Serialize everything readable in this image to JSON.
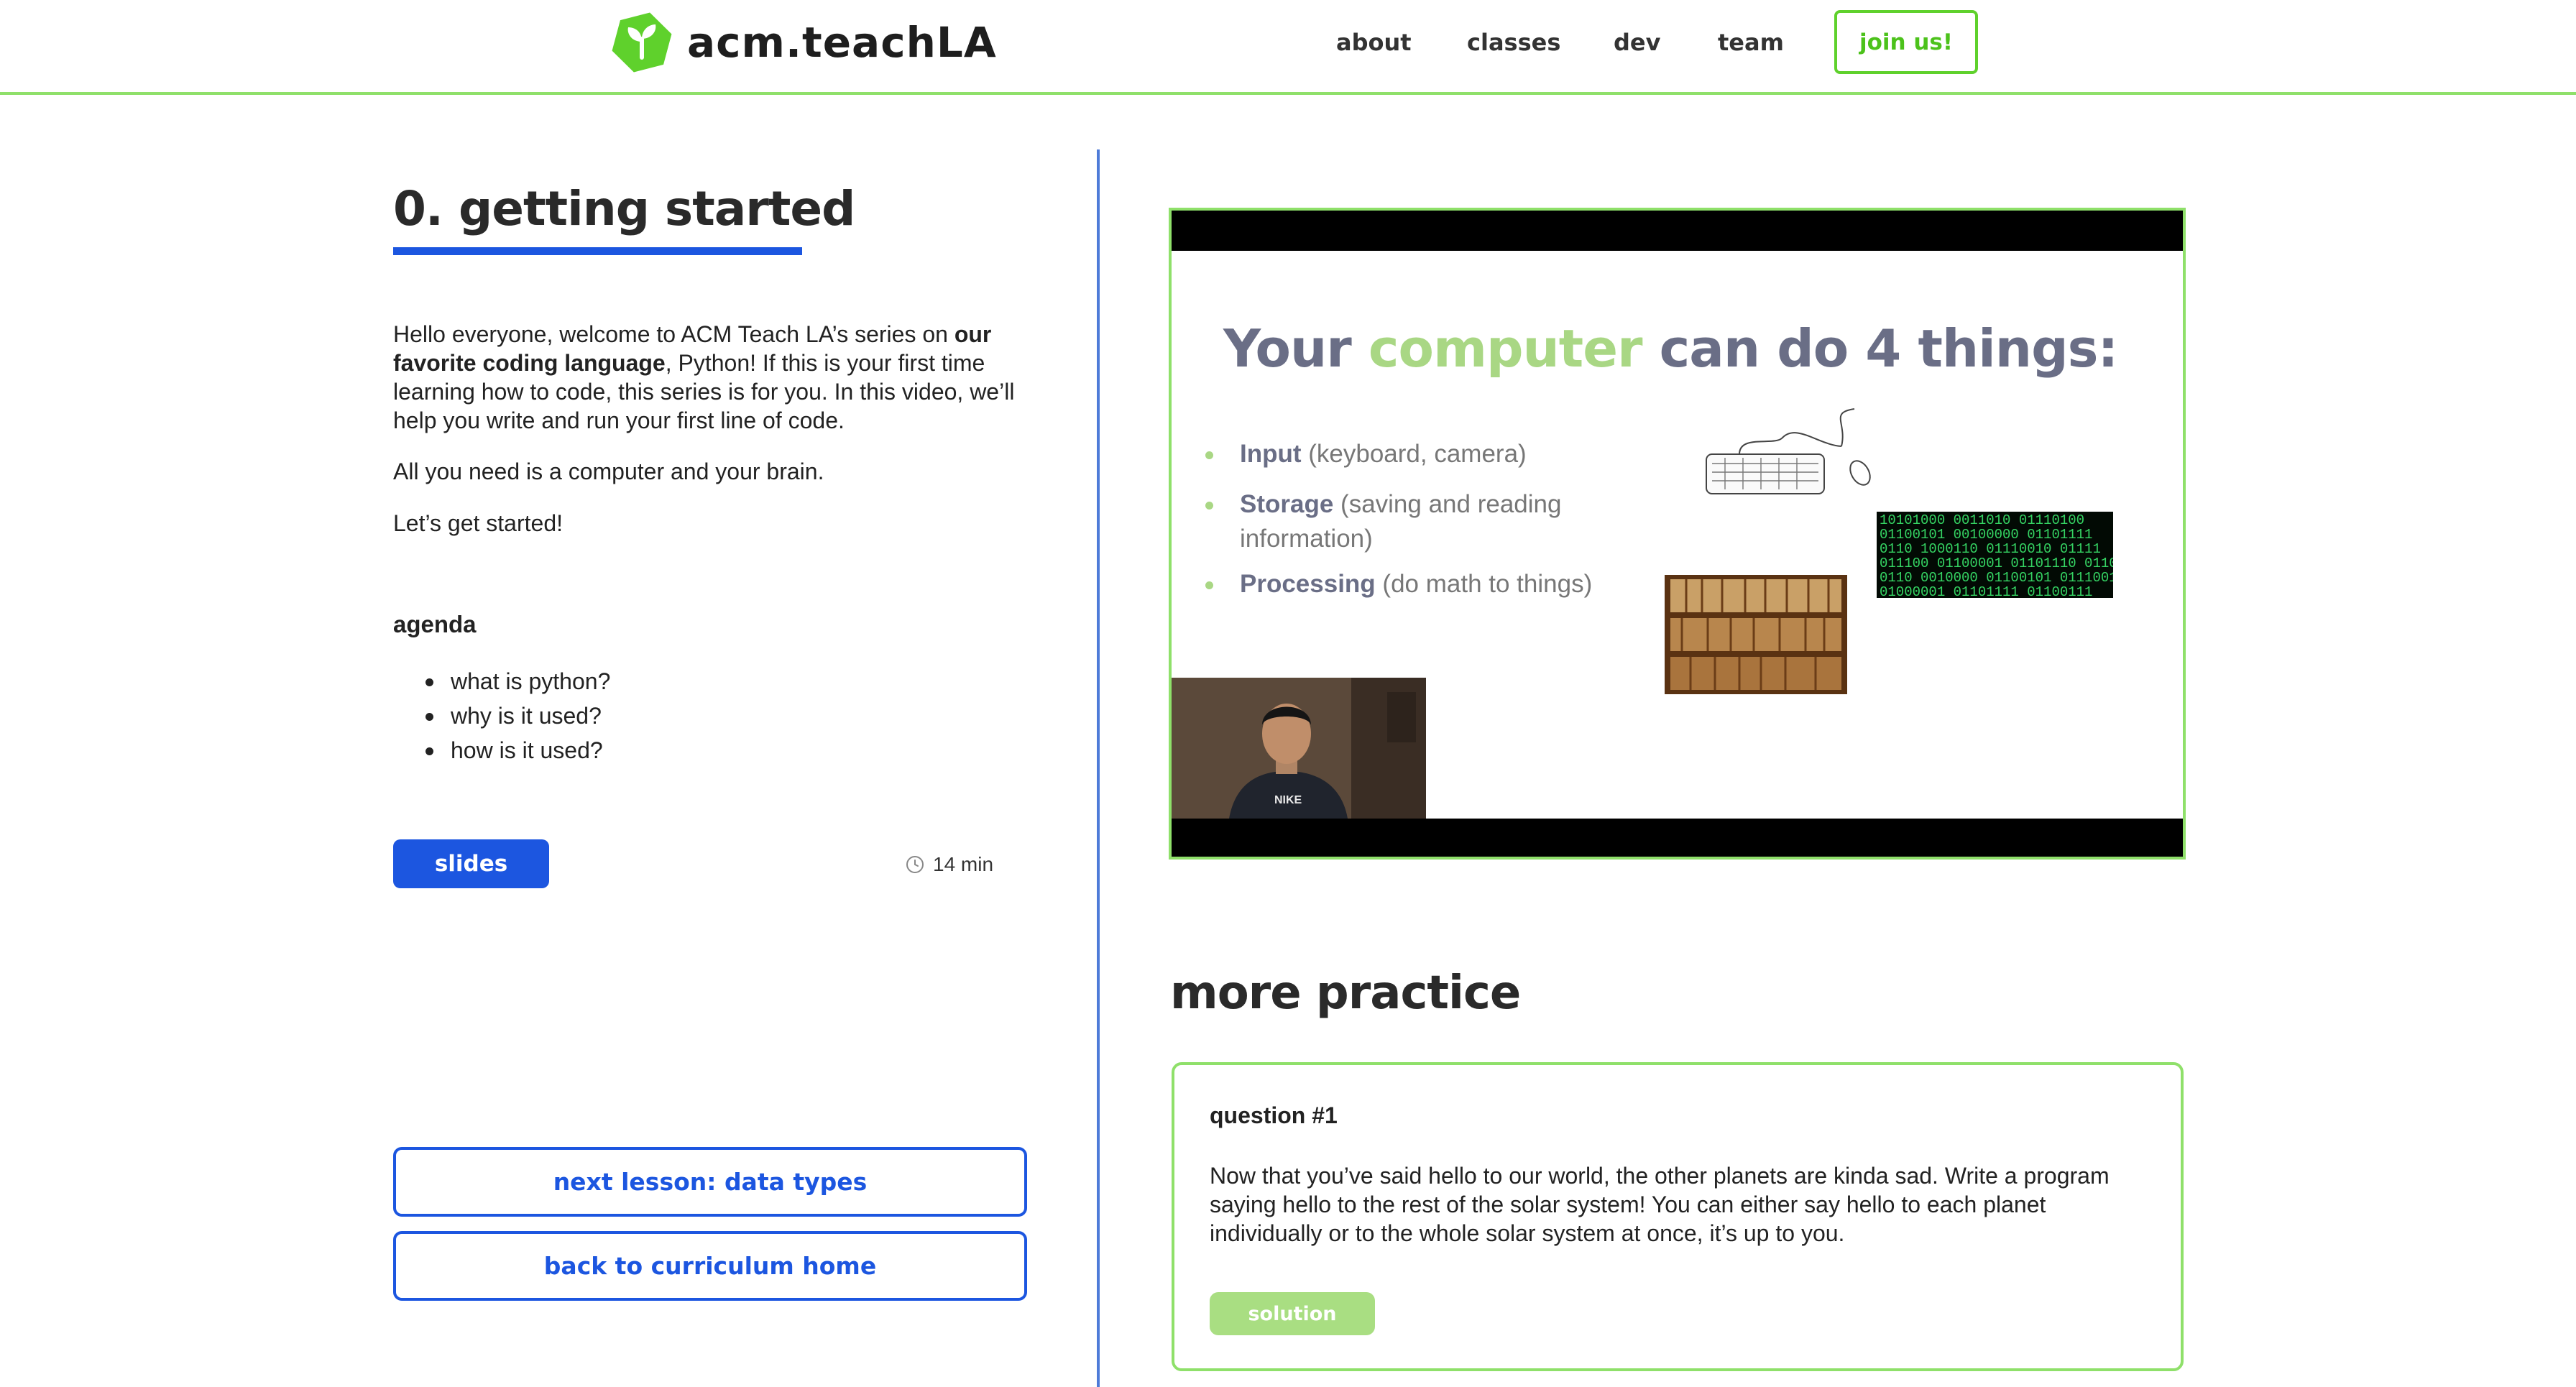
{
  "header": {
    "brand": "acm.teachLA",
    "logo_icon": "sprout-icon",
    "nav": [
      {
        "label": "about"
      },
      {
        "label": "classes"
      },
      {
        "label": "dev"
      },
      {
        "label": "team"
      }
    ],
    "join_label": "join us!"
  },
  "colors": {
    "brand_green": "#5fd12c",
    "accent_blue": "#1c56e0",
    "border_green": "#8fe06a",
    "solution_green": "#a9de82"
  },
  "lesson": {
    "title": "0. getting started",
    "intro_1": "Hello everyone, welcome to ACM Teach LA’s series on ",
    "intro_bold": "our favorite coding language",
    "intro_2": ", Python! If this is your first time learning how to code, this series is for you. In this video, we’ll help you write and run your first line of code.",
    "para2": "All you need is a computer and your brain.",
    "para3": "Let’s get started!",
    "agenda_heading": "agenda",
    "agenda": [
      "what is python?",
      "why is it used?",
      "how is it used?"
    ],
    "slides_label": "slides",
    "duration": "14 min",
    "next_label": "next lesson: data types",
    "back_label": "back to curriculum home"
  },
  "video": {
    "title_1": "Your ",
    "title_accent": "computer",
    "title_2": " can do 4 things:",
    "bullets": [
      {
        "bold": "Input",
        "rest": " (keyboard, camera)"
      },
      {
        "bold": "Storage",
        "rest": " (saving and reading information)"
      },
      {
        "bold": "Processing",
        "rest": " (do math to things)"
      }
    ]
  },
  "practice": {
    "heading": "more practice",
    "question_label": "question #1",
    "question_text": "Now that you’ve said hello to our world, the other planets are kinda sad. Write a program saying hello to the rest of the solar system! You can either say hello to each planet individually or to the whole solar system at once, it’s up to you.",
    "solution_label": "solution"
  }
}
